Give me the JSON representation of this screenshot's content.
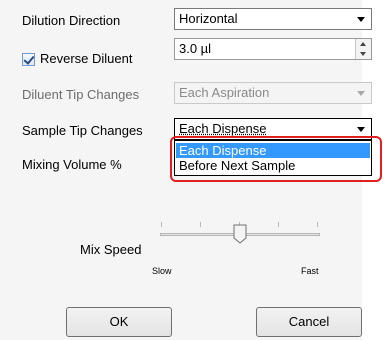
{
  "form": {
    "dilution_direction": {
      "label": "Dilution Direction",
      "value": "Horizontal"
    },
    "reverse_diluent": {
      "label": "Reverse Diluent",
      "checked": true,
      "value": "3.0 µl"
    },
    "diluent_tip_changes": {
      "label": "Diluent Tip Changes",
      "value": "Each Aspiration"
    },
    "sample_tip_changes": {
      "label": "Sample Tip Changes",
      "value": "Each Dispense",
      "options": [
        "Each Dispense",
        "Before Next Sample"
      ]
    },
    "mixing_volume": {
      "label": "Mixing Volume %"
    },
    "mix_speed": {
      "label": "Mix Speed",
      "min_label": "Slow",
      "max_label": "Fast",
      "level": 0.5
    }
  },
  "buttons": {
    "ok": "OK",
    "cancel": "Cancel"
  },
  "colors": {
    "selection": "#3399ff",
    "highlight_ring": "#e02020"
  }
}
